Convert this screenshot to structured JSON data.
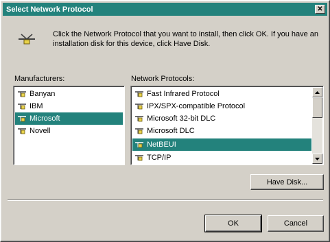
{
  "window": {
    "title": "Select Network Protocol",
    "close_label": "✕"
  },
  "instructions": "Click the Network Protocol that you want to install, then click OK. If you have an installation disk for this device, click Have Disk.",
  "manufacturers": {
    "label": "Manufacturers:",
    "items": [
      "Banyan",
      "IBM",
      "Microsoft",
      "Novell"
    ],
    "selected": "Microsoft"
  },
  "protocols": {
    "label": "Network Protocols:",
    "items": [
      "Fast Infrared Protocol",
      "IPX/SPX-compatible Protocol",
      "Microsoft 32-bit DLC",
      "Microsoft DLC",
      "NetBEUI",
      "TCP/IP"
    ],
    "selected": "NetBEUI"
  },
  "buttons": {
    "have_disk": "Have Disk...",
    "ok": "OK",
    "cancel": "Cancel"
  },
  "colors": {
    "titlebar": "#23827c",
    "selection": "#23827c",
    "face": "#d4d0c8"
  },
  "icons": {
    "header": "network-cable-icon",
    "list_item": "network-protocol-icon"
  }
}
